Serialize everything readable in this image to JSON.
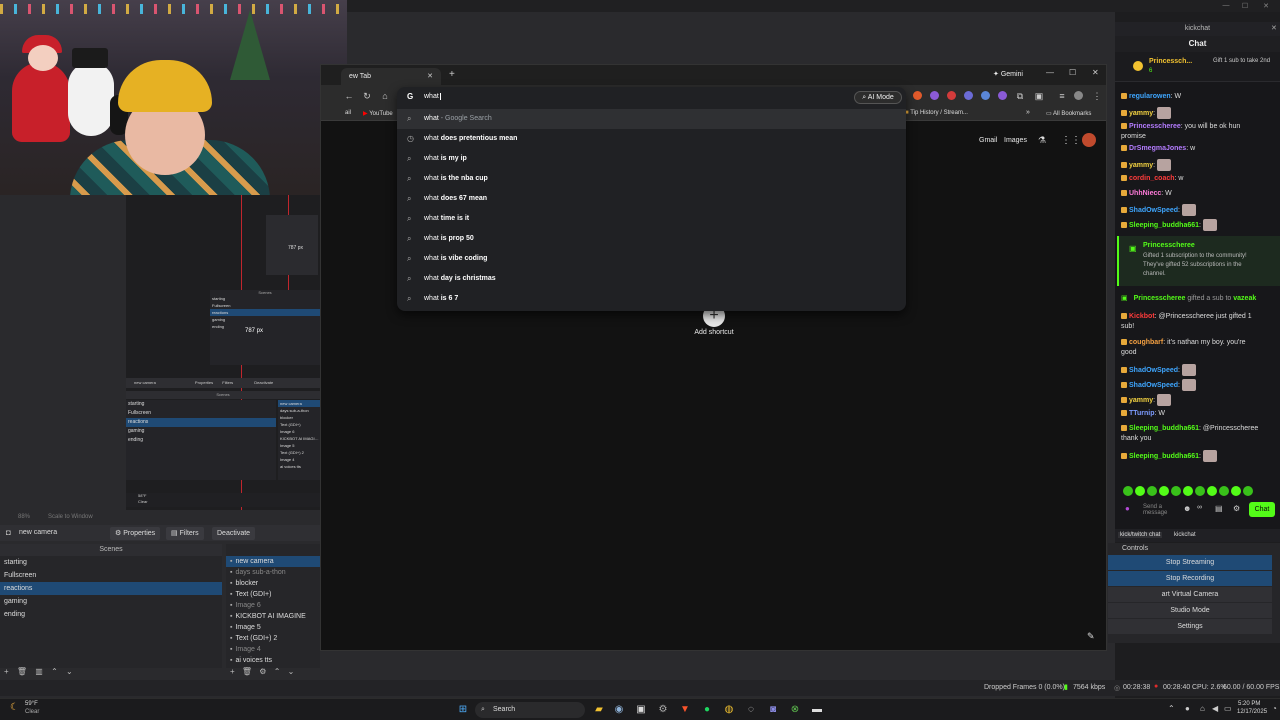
{
  "obs": {
    "scale_label": "88%",
    "scale_window_label": "Scale to Window",
    "context_source": "new camera",
    "context_buttons": [
      "Properties",
      "Filters",
      "Deactivate"
    ],
    "scenes_header": "Scenes",
    "sources_header_abbrev": "S",
    "scenes": [
      "starting",
      "Fullscreen",
      "reactions",
      "gaming",
      "ending"
    ],
    "selected_scene_index": 2,
    "sources": [
      "new camera",
      "days sub-a-thon",
      "blocker",
      "Text (GDI+)",
      "Image 6",
      "KICKBOT AI IMAGINE",
      "Image 5",
      "Text (GDI+) 2",
      "Image 4",
      "ai voices tts"
    ],
    "mini_preview": {
      "size_label_top": "787 px",
      "size_label_mid": "787 px",
      "scenes_header": "Scenes",
      "scenes": [
        "starting",
        "Fullscreen",
        "reactions",
        "gaming",
        "ending"
      ],
      "sources": [
        "new camera",
        "days sub-a-thon",
        "blocker",
        "Text (GDI+)",
        "Image 6",
        "KICKBOT AI IMAGINE",
        "Image 5",
        "Text (GDI+) 2",
        "Image 4",
        "ai voices tts"
      ],
      "buttons": [
        "new camera",
        "Properties",
        "Filters",
        "Deactivate"
      ],
      "weather_temp": "58°F",
      "weather_cond": "Clear"
    },
    "controls_tabs": [
      "kick/twitch chat",
      "kickchat"
    ],
    "controls_header": "Controls",
    "controls": [
      "Stop Streaming",
      "Stop Recording",
      "art Virtual Camera",
      "Studio Mode",
      "Settings"
    ],
    "status": {
      "dropped_frames": "Dropped Frames 0 (0.0%)",
      "bitrate": "7564 kbps",
      "stream_time": "00:28:38",
      "rec_time": "00:28:40",
      "cpu": "CPU: 2.6%",
      "fps": "60.00 / 60.00 FPS"
    }
  },
  "browser": {
    "tab_title": "ew Tab",
    "gemini_label": "Gemini",
    "omnibox_text": "what",
    "ai_mode_label": "AI Mode",
    "bookmarks": [
      "ail",
      "YouTube",
      "Tip History / Stream...",
      "All Bookmarks"
    ],
    "suggestions": [
      {
        "prefix": "what",
        "suffix": "",
        "extra": " - Google Search",
        "icon": "search-icon"
      },
      {
        "prefix": "what",
        "suffix": " does pretentious mean",
        "extra": "",
        "icon": "history-icon"
      },
      {
        "prefix": "what",
        "suffix": " is my ip",
        "extra": "",
        "icon": "search-icon"
      },
      {
        "prefix": "what",
        "suffix": " is the nba cup",
        "extra": "",
        "icon": "search-icon"
      },
      {
        "prefix": "what",
        "suffix": " does 67 mean",
        "extra": "",
        "icon": "search-icon"
      },
      {
        "prefix": "what",
        "suffix": " time is it",
        "extra": "",
        "icon": "search-icon"
      },
      {
        "prefix": "what",
        "suffix": " is prop 50",
        "extra": "",
        "icon": "search-icon"
      },
      {
        "prefix": "what",
        "suffix": " is vibe coding",
        "extra": "",
        "icon": "search-icon"
      },
      {
        "prefix": "what",
        "suffix": " day is christmas",
        "extra": "",
        "icon": "search-icon"
      },
      {
        "prefix": "what",
        "suffix": " is 6 7",
        "extra": "",
        "icon": "search-icon"
      }
    ],
    "ntp_links": [
      "Gmail",
      "Images"
    ],
    "add_shortcut_label": "Add shortcut"
  },
  "chat": {
    "window_title": "kickchat",
    "title": "Chat",
    "pinned": {
      "user": "Princessch...",
      "count": "6",
      "text": "Gift 1 sub to take 2nd"
    },
    "messages": [
      {
        "user": "regularowen",
        "text": ": W",
        "color": "#3ea6ff"
      },
      {
        "user": "yammy",
        "text": ":",
        "color": "#f5d442",
        "emote": true
      },
      {
        "user": "Princesscheree",
        "text": ": you will be ok hun",
        "text2": "promise",
        "color": "#b47cff"
      },
      {
        "user": "DrSmegmaJones",
        "text": ": w",
        "color": "#b47cff"
      },
      {
        "user": "yammy",
        "text": ":",
        "color": "#f5d442",
        "emote": true
      },
      {
        "user": "cordin_coach",
        "text": ": w",
        "color": "#ff3b3b"
      },
      {
        "user": "UhhNiecc",
        "text": ": W",
        "color": "#ff7ad9"
      },
      {
        "user": "ShadOwSpeed",
        "text": ":",
        "color": "#3ea6ff",
        "emote": true
      },
      {
        "user": "Sleeping_buddha661",
        "text": ":",
        "color": "#53fc18",
        "emote": true
      }
    ],
    "sub_card_1": {
      "user": "Princesscheree",
      "line1": "Gifted 1 subscription to the community!",
      "line2": "They've gifted 52 subscriptions in the",
      "line3": "channel."
    },
    "sub_card_2": {
      "user": "Princesscheree",
      "mid": " gifted a sub to ",
      "target": "vazeak"
    },
    "messages2": [
      {
        "user": "Kickbot",
        "text": ": @Princesscheree just gifted 1",
        "text2": "sub!",
        "color": "#ff3b3b"
      },
      {
        "user": "coughbarf",
        "text": ": it's nathan my boy. you're",
        "text2": "good",
        "color": "#f5a142"
      },
      {
        "user": "ShadOwSpeed",
        "text": ":",
        "color": "#3ea6ff",
        "emote": true
      },
      {
        "user": "ShadOwSpeed",
        "text": ":",
        "color": "#3ea6ff",
        "emote": true
      },
      {
        "user": "yammy",
        "text": ":",
        "color": "#f5d442",
        "emote": true
      },
      {
        "user": "TTurnip",
        "text": ": W",
        "color": "#7c9bff"
      },
      {
        "user": "Sleeping_buddha661",
        "text": ": @Princesscheree",
        "text2": "thank you",
        "color": "#53fc18"
      },
      {
        "user": "Sleeping_buddha661",
        "text": ":",
        "color": "#53fc18",
        "emote": true
      }
    ],
    "input_placeholder": "Send a message",
    "send_label": "Chat"
  },
  "taskbar": {
    "weather_temp": "59°F",
    "weather_cond": "Clear",
    "search_label": "Search",
    "time": "5:20 PM",
    "date": "12/17/2025"
  }
}
